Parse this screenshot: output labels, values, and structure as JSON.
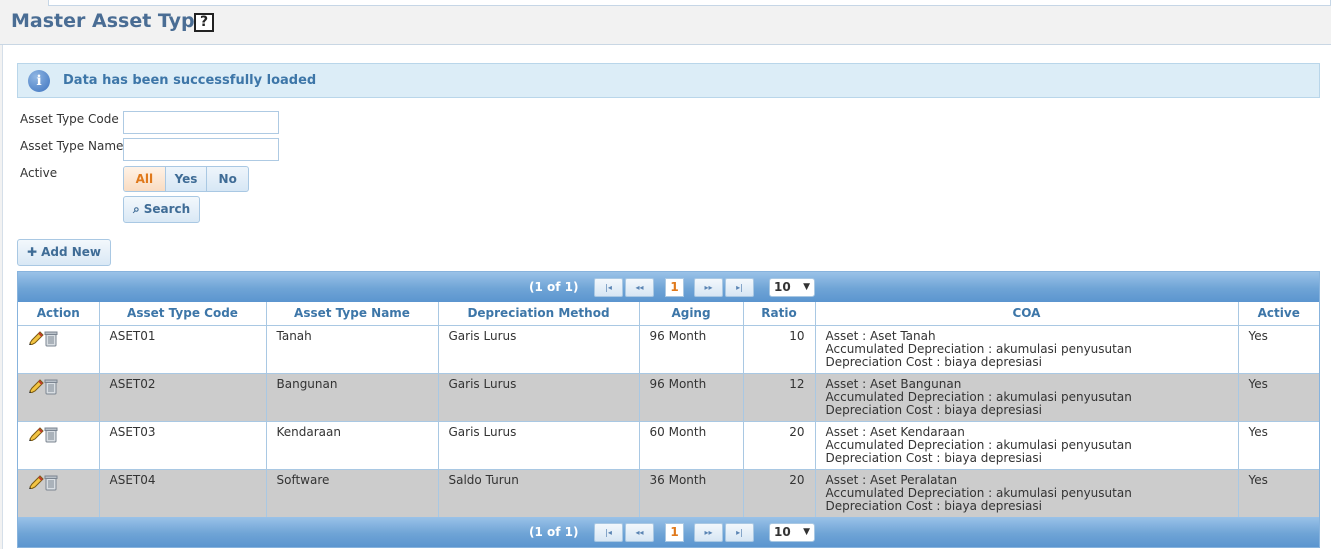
{
  "page": {
    "title": "Master Asset Type",
    "help_label": "?"
  },
  "message": {
    "text": "Data has been successfully loaded",
    "icon": "info-icon"
  },
  "filter": {
    "code_label": "Asset Type Code",
    "code_value": "",
    "name_label": "Asset Type Name",
    "name_value": "",
    "active_label": "Active",
    "active_options": [
      "All",
      "Yes",
      "No"
    ],
    "active_selected": "All",
    "search_label": "Search",
    "search_icon": "search-icon"
  },
  "toolbar": {
    "add_label": "Add New",
    "add_icon": "plus-icon"
  },
  "pager": {
    "count_text": "(1 of 1)",
    "current_page": "1",
    "first_glyph": "|◂",
    "prev_glyph": "◂◂",
    "next_glyph": "▸▸",
    "last_glyph": "▸|",
    "rows_per_page": "10"
  },
  "table": {
    "columns": [
      "Action",
      "Asset Type Code",
      "Asset Type Name",
      "Depreciation Method",
      "Aging",
      "Ratio",
      "COA",
      "Active"
    ],
    "rows": [
      {
        "code": "ASET01",
        "name": "Tanah",
        "method": "Garis Lurus",
        "aging": "96 Month",
        "ratio": "10",
        "coa": [
          "Asset : Aset Tanah",
          "Accumulated Depreciation : akumulasi penyusutan",
          "Depreciation Cost : biaya depresiasi"
        ],
        "active": "Yes"
      },
      {
        "code": "ASET02",
        "name": "Bangunan",
        "method": "Garis Lurus",
        "aging": "96 Month",
        "ratio": "12",
        "coa": [
          "Asset : Aset Bangunan",
          "Accumulated Depreciation : akumulasi penyusutan",
          "Depreciation Cost : biaya depresiasi"
        ],
        "active": "Yes"
      },
      {
        "code": "ASET03",
        "name": "Kendaraan",
        "method": "Garis Lurus",
        "aging": "60 Month",
        "ratio": "20",
        "coa": [
          "Asset : Aset Kendaraan",
          "Accumulated Depreciation : akumulasi penyusutan",
          "Depreciation Cost : biaya depresiasi"
        ],
        "active": "Yes"
      },
      {
        "code": "ASET04",
        "name": "Software",
        "method": "Saldo Turun",
        "aging": "36 Month",
        "ratio": "20",
        "coa": [
          "Asset : Aset Peralatan",
          "Accumulated Depreciation : akumulasi penyusutan",
          "Depreciation Cost : biaya depresiasi"
        ],
        "active": "Yes"
      }
    ]
  },
  "colors": {
    "title": "#4a6d94",
    "accent": "#3d76a8",
    "selected": "#e0791b",
    "alt_row": "#cccccc",
    "pager": "#6fa4d6"
  }
}
